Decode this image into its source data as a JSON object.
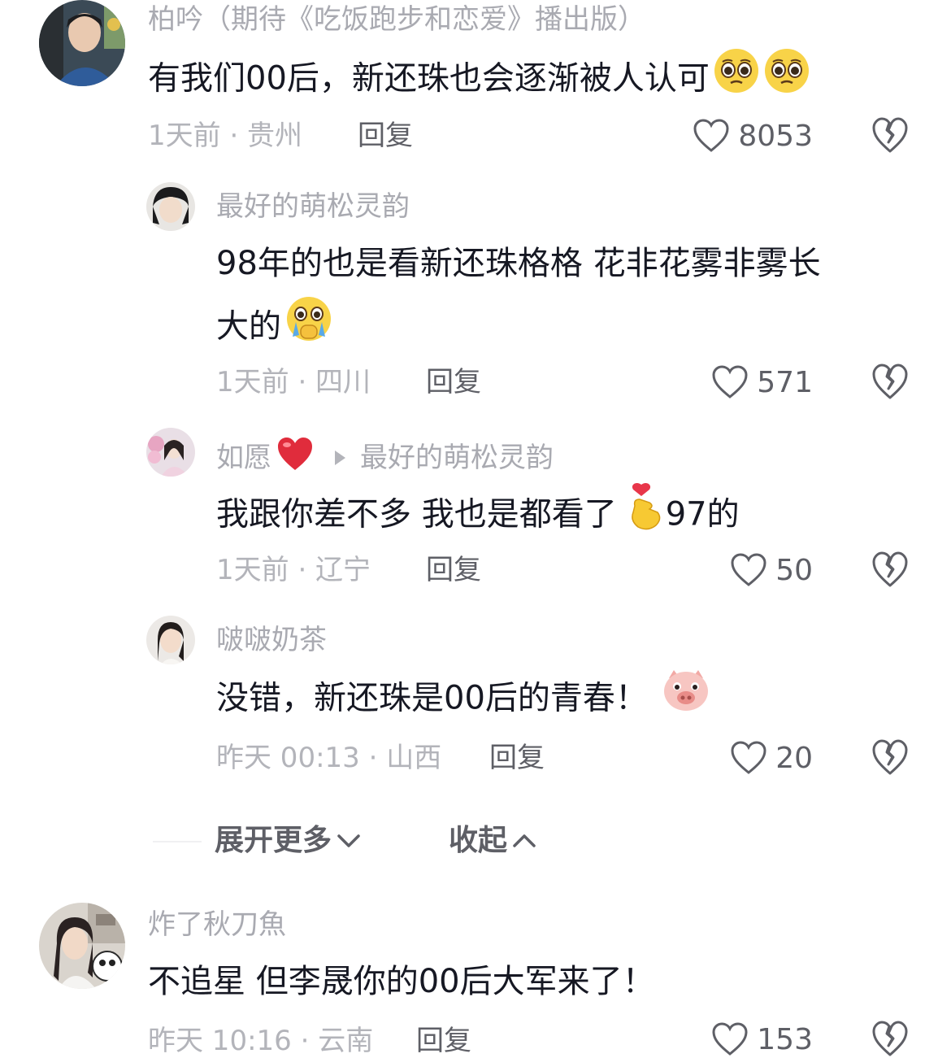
{
  "comments": [
    {
      "username": "柏吟（期待《吃饭跑步和恋爱》播出版）",
      "text": "有我们00后，新还珠也会逐渐被人认可",
      "emoji": [
        "pleading-face-icon",
        "pleading-face-icon"
      ],
      "time_location": "1天前 · 贵州",
      "reply_label": "回复",
      "likes": "8053"
    }
  ],
  "replies": [
    {
      "username": "最好的萌松灵韵",
      "text_line1": "98年的也是看新还珠格格 花非花雾非雾长",
      "text_line2": "大的",
      "emoji": "face-holding-back-tears-icon",
      "time_location": "1天前 · 四川",
      "reply_label": "回复",
      "likes": "571"
    },
    {
      "username": "如愿",
      "username_emoji": "red-heart-icon",
      "reply_to": "最好的萌松灵韵",
      "text": "我跟你差不多 我也是都看了",
      "text_suffix": "97的",
      "emoji": "hand-with-index-finger-and-thumb-crossed-icon",
      "time_location": "1天前 · 辽宁",
      "reply_label": "回复",
      "likes": "50"
    },
    {
      "username": "啵啵奶茶",
      "text": "没错，新还珠是00后的青春！",
      "emoji": "pig-face-icon",
      "time_location": "昨天 00:13 · 山西",
      "reply_label": "回复",
      "likes": "20"
    }
  ],
  "thread_controls": {
    "expand_label": "展开更多",
    "collapse_label": "收起"
  },
  "last_comment": {
    "username": "炸了秋刀魚",
    "text": "不追星 但李晟你的00后大军来了！",
    "time_location": "昨天 10:16 · 云南",
    "reply_label": "回复",
    "likes": "153"
  }
}
